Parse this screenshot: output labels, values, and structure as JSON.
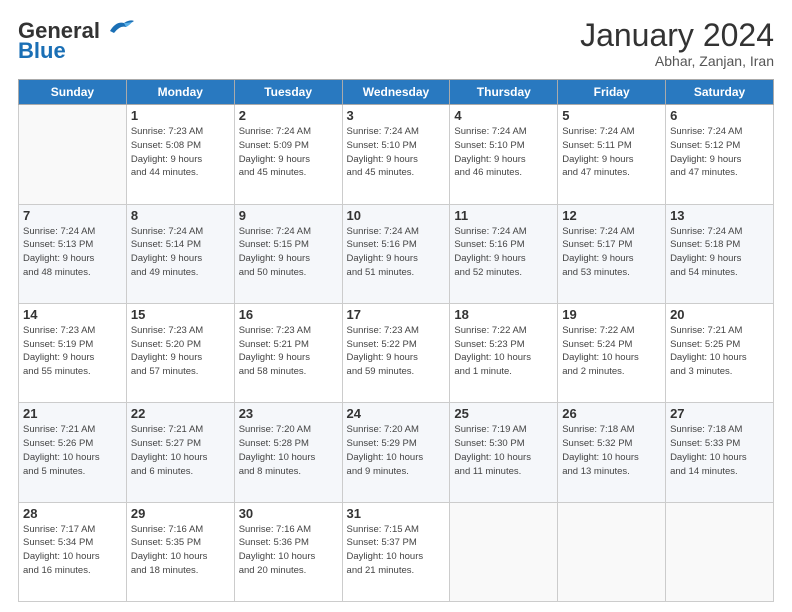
{
  "header": {
    "logo_general": "General",
    "logo_blue": "Blue",
    "month_title": "January 2024",
    "subtitle": "Abhar, Zanjan, Iran"
  },
  "weekdays": [
    "Sunday",
    "Monday",
    "Tuesday",
    "Wednesday",
    "Thursday",
    "Friday",
    "Saturday"
  ],
  "weeks": [
    [
      {
        "day": "",
        "info": ""
      },
      {
        "day": "1",
        "info": "Sunrise: 7:23 AM\nSunset: 5:08 PM\nDaylight: 9 hours\nand 44 minutes."
      },
      {
        "day": "2",
        "info": "Sunrise: 7:24 AM\nSunset: 5:09 PM\nDaylight: 9 hours\nand 45 minutes."
      },
      {
        "day": "3",
        "info": "Sunrise: 7:24 AM\nSunset: 5:10 PM\nDaylight: 9 hours\nand 45 minutes."
      },
      {
        "day": "4",
        "info": "Sunrise: 7:24 AM\nSunset: 5:10 PM\nDaylight: 9 hours\nand 46 minutes."
      },
      {
        "day": "5",
        "info": "Sunrise: 7:24 AM\nSunset: 5:11 PM\nDaylight: 9 hours\nand 47 minutes."
      },
      {
        "day": "6",
        "info": "Sunrise: 7:24 AM\nSunset: 5:12 PM\nDaylight: 9 hours\nand 47 minutes."
      }
    ],
    [
      {
        "day": "7",
        "info": "Sunrise: 7:24 AM\nSunset: 5:13 PM\nDaylight: 9 hours\nand 48 minutes."
      },
      {
        "day": "8",
        "info": "Sunrise: 7:24 AM\nSunset: 5:14 PM\nDaylight: 9 hours\nand 49 minutes."
      },
      {
        "day": "9",
        "info": "Sunrise: 7:24 AM\nSunset: 5:15 PM\nDaylight: 9 hours\nand 50 minutes."
      },
      {
        "day": "10",
        "info": "Sunrise: 7:24 AM\nSunset: 5:16 PM\nDaylight: 9 hours\nand 51 minutes."
      },
      {
        "day": "11",
        "info": "Sunrise: 7:24 AM\nSunset: 5:16 PM\nDaylight: 9 hours\nand 52 minutes."
      },
      {
        "day": "12",
        "info": "Sunrise: 7:24 AM\nSunset: 5:17 PM\nDaylight: 9 hours\nand 53 minutes."
      },
      {
        "day": "13",
        "info": "Sunrise: 7:24 AM\nSunset: 5:18 PM\nDaylight: 9 hours\nand 54 minutes."
      }
    ],
    [
      {
        "day": "14",
        "info": "Sunrise: 7:23 AM\nSunset: 5:19 PM\nDaylight: 9 hours\nand 55 minutes."
      },
      {
        "day": "15",
        "info": "Sunrise: 7:23 AM\nSunset: 5:20 PM\nDaylight: 9 hours\nand 57 minutes."
      },
      {
        "day": "16",
        "info": "Sunrise: 7:23 AM\nSunset: 5:21 PM\nDaylight: 9 hours\nand 58 minutes."
      },
      {
        "day": "17",
        "info": "Sunrise: 7:23 AM\nSunset: 5:22 PM\nDaylight: 9 hours\nand 59 minutes."
      },
      {
        "day": "18",
        "info": "Sunrise: 7:22 AM\nSunset: 5:23 PM\nDaylight: 10 hours\nand 1 minute."
      },
      {
        "day": "19",
        "info": "Sunrise: 7:22 AM\nSunset: 5:24 PM\nDaylight: 10 hours\nand 2 minutes."
      },
      {
        "day": "20",
        "info": "Sunrise: 7:21 AM\nSunset: 5:25 PM\nDaylight: 10 hours\nand 3 minutes."
      }
    ],
    [
      {
        "day": "21",
        "info": "Sunrise: 7:21 AM\nSunset: 5:26 PM\nDaylight: 10 hours\nand 5 minutes."
      },
      {
        "day": "22",
        "info": "Sunrise: 7:21 AM\nSunset: 5:27 PM\nDaylight: 10 hours\nand 6 minutes."
      },
      {
        "day": "23",
        "info": "Sunrise: 7:20 AM\nSunset: 5:28 PM\nDaylight: 10 hours\nand 8 minutes."
      },
      {
        "day": "24",
        "info": "Sunrise: 7:20 AM\nSunset: 5:29 PM\nDaylight: 10 hours\nand 9 minutes."
      },
      {
        "day": "25",
        "info": "Sunrise: 7:19 AM\nSunset: 5:30 PM\nDaylight: 10 hours\nand 11 minutes."
      },
      {
        "day": "26",
        "info": "Sunrise: 7:18 AM\nSunset: 5:32 PM\nDaylight: 10 hours\nand 13 minutes."
      },
      {
        "day": "27",
        "info": "Sunrise: 7:18 AM\nSunset: 5:33 PM\nDaylight: 10 hours\nand 14 minutes."
      }
    ],
    [
      {
        "day": "28",
        "info": "Sunrise: 7:17 AM\nSunset: 5:34 PM\nDaylight: 10 hours\nand 16 minutes."
      },
      {
        "day": "29",
        "info": "Sunrise: 7:16 AM\nSunset: 5:35 PM\nDaylight: 10 hours\nand 18 minutes."
      },
      {
        "day": "30",
        "info": "Sunrise: 7:16 AM\nSunset: 5:36 PM\nDaylight: 10 hours\nand 20 minutes."
      },
      {
        "day": "31",
        "info": "Sunrise: 7:15 AM\nSunset: 5:37 PM\nDaylight: 10 hours\nand 21 minutes."
      },
      {
        "day": "",
        "info": ""
      },
      {
        "day": "",
        "info": ""
      },
      {
        "day": "",
        "info": ""
      }
    ]
  ]
}
